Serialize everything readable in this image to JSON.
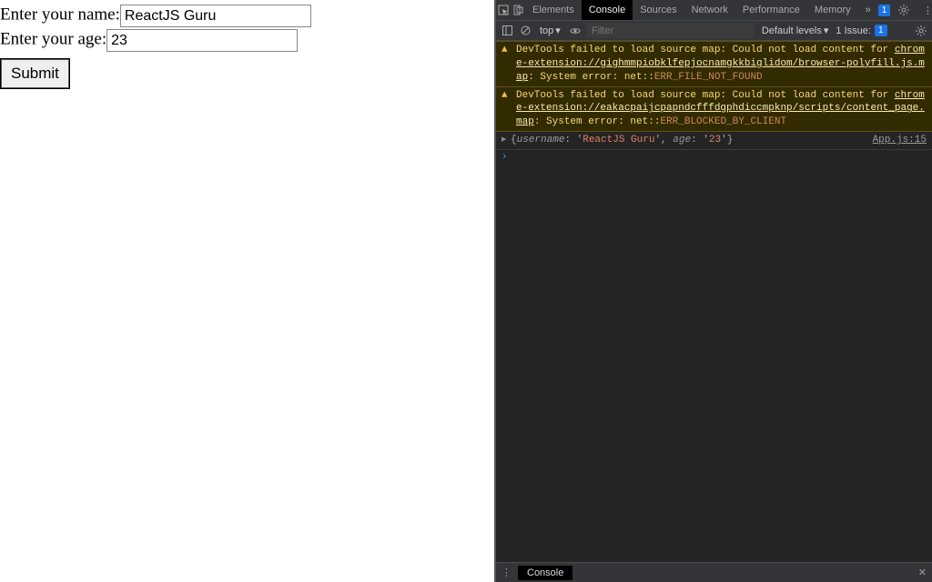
{
  "form": {
    "name_label": "Enter your name:",
    "name_value": "ReactJS Guru",
    "age_label": "Enter your age:",
    "age_value": "23",
    "submit_label": "Submit"
  },
  "devtools": {
    "tabs": {
      "elements": "Elements",
      "console": "Console",
      "sources": "Sources",
      "network": "Network",
      "performance": "Performance",
      "memory": "Memory"
    },
    "badge_top": "1",
    "filterbar": {
      "context": "top",
      "filter_placeholder": "Filter",
      "levels": "Default levels",
      "issues_label": "1 Issue:",
      "issues_badge": "1"
    },
    "warnings": [
      {
        "prefix": "DevTools failed to load source map: Could not load content for ",
        "url": "chrome-extension://gighmmpiobklfepjocnamgkkbiglidom/browser-polyfill.js.map",
        "suffix_a": ": System error: net::",
        "err": "ERR_FILE_NOT_FOUND"
      },
      {
        "prefix": "DevTools failed to load source map: Could not load content for ",
        "url": "chrome-extension://eakacpaijcpapndcfffdgphdiccmpknp/scripts/content_page.map",
        "suffix_a": ": System error: net::",
        "err": "ERR_BLOCKED_BY_CLIENT"
      }
    ],
    "log": {
      "text_keys": [
        "username",
        "age"
      ],
      "username": "ReactJS Guru",
      "age": "23",
      "source": "App.js:15"
    },
    "drawer": {
      "console": "Console"
    }
  }
}
